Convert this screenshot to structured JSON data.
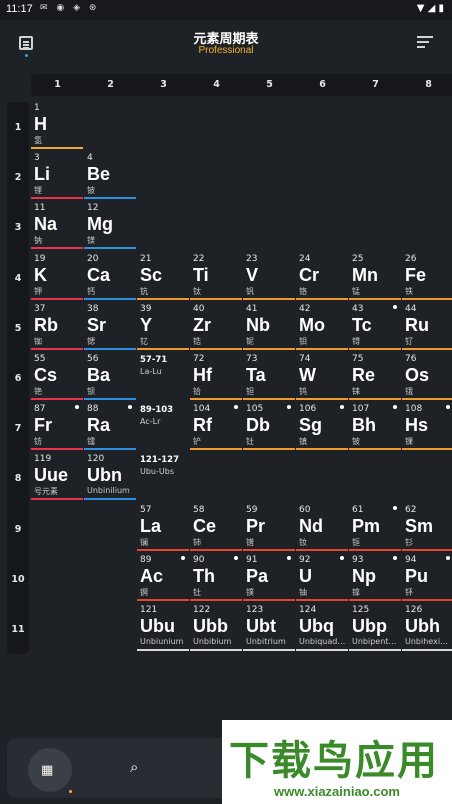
{
  "status_bar": {
    "time": "11:17"
  },
  "app_bar": {
    "title": "元素周期表",
    "subtitle": "Professional"
  },
  "columns": [
    "1",
    "2",
    "3",
    "4",
    "5",
    "6",
    "7",
    "8"
  ],
  "rows": [
    "1",
    "2",
    "3",
    "4",
    "5",
    "6",
    "7",
    "8",
    "9",
    "10",
    "11"
  ],
  "colors": {
    "alkali": "#e8334f",
    "alkaline_earth": "#2f8fe0",
    "transition": "#f39a2c",
    "lanthanide_actinide": "#e8452f",
    "superheavy": "#d9d9d9",
    "hydrogen": "#f2a93b"
  },
  "elements": [
    {
      "n": "1",
      "s": "H",
      "name": "氢",
      "cat": "hydrogen",
      "r": 0,
      "c": 0
    },
    {
      "n": "3",
      "s": "Li",
      "name": "锂",
      "cat": "alkali",
      "r": 1,
      "c": 0
    },
    {
      "n": "4",
      "s": "Be",
      "name": "铍",
      "cat": "alkaline_earth",
      "r": 1,
      "c": 1
    },
    {
      "n": "11",
      "s": "Na",
      "name": "钠",
      "cat": "alkali",
      "r": 2,
      "c": 0
    },
    {
      "n": "12",
      "s": "Mg",
      "name": "镁",
      "cat": "alkaline_earth",
      "r": 2,
      "c": 1
    },
    {
      "n": "19",
      "s": "K",
      "name": "钾",
      "cat": "alkali",
      "r": 3,
      "c": 0
    },
    {
      "n": "20",
      "s": "Ca",
      "name": "钙",
      "cat": "alkaline_earth",
      "r": 3,
      "c": 1
    },
    {
      "n": "21",
      "s": "Sc",
      "name": "钪",
      "cat": "transition",
      "r": 3,
      "c": 2
    },
    {
      "n": "22",
      "s": "Ti",
      "name": "钛",
      "cat": "transition",
      "r": 3,
      "c": 3
    },
    {
      "n": "23",
      "s": "V",
      "name": "钒",
      "cat": "transition",
      "r": 3,
      "c": 4
    },
    {
      "n": "24",
      "s": "Cr",
      "name": "铬",
      "cat": "transition",
      "r": 3,
      "c": 5
    },
    {
      "n": "25",
      "s": "Mn",
      "name": "锰",
      "cat": "transition",
      "r": 3,
      "c": 6
    },
    {
      "n": "26",
      "s": "Fe",
      "name": "铁",
      "cat": "transition",
      "r": 3,
      "c": 7
    },
    {
      "n": "37",
      "s": "Rb",
      "name": "铷",
      "cat": "alkali",
      "r": 4,
      "c": 0
    },
    {
      "n": "38",
      "s": "Sr",
      "name": "锶",
      "cat": "alkaline_earth",
      "r": 4,
      "c": 1
    },
    {
      "n": "39",
      "s": "Y",
      "name": "钇",
      "cat": "transition",
      "r": 4,
      "c": 2
    },
    {
      "n": "40",
      "s": "Zr",
      "name": "锆",
      "cat": "transition",
      "r": 4,
      "c": 3
    },
    {
      "n": "41",
      "s": "Nb",
      "name": "铌",
      "cat": "transition",
      "r": 4,
      "c": 4
    },
    {
      "n": "42",
      "s": "Mo",
      "name": "钼",
      "cat": "transition",
      "r": 4,
      "c": 5
    },
    {
      "n": "43",
      "s": "Tc",
      "name": "锝",
      "cat": "transition",
      "r": 4,
      "c": 6,
      "dot": true
    },
    {
      "n": "44",
      "s": "Ru",
      "name": "钌",
      "cat": "transition",
      "r": 4,
      "c": 7
    },
    {
      "n": "55",
      "s": "Cs",
      "name": "铯",
      "cat": "alkali",
      "r": 5,
      "c": 0
    },
    {
      "n": "56",
      "s": "Ba",
      "name": "钡",
      "cat": "alkaline_earth",
      "r": 5,
      "c": 1
    },
    {
      "n": "72",
      "s": "Hf",
      "name": "铪",
      "cat": "transition",
      "r": 5,
      "c": 3
    },
    {
      "n": "73",
      "s": "Ta",
      "name": "钽",
      "cat": "transition",
      "r": 5,
      "c": 4
    },
    {
      "n": "74",
      "s": "W",
      "name": "钨",
      "cat": "transition",
      "r": 5,
      "c": 5
    },
    {
      "n": "75",
      "s": "Re",
      "name": "铼",
      "cat": "transition",
      "r": 5,
      "c": 6
    },
    {
      "n": "76",
      "s": "Os",
      "name": "锇",
      "cat": "transition",
      "r": 5,
      "c": 7
    },
    {
      "n": "87",
      "s": "Fr",
      "name": "钫",
      "cat": "alkali",
      "r": 6,
      "c": 0,
      "dot": true
    },
    {
      "n": "88",
      "s": "Ra",
      "name": "镭",
      "cat": "alkaline_earth",
      "r": 6,
      "c": 1,
      "dot": true
    },
    {
      "n": "104",
      "s": "Rf",
      "name": "铲",
      "cat": "transition",
      "r": 6,
      "c": 3,
      "dot": true
    },
    {
      "n": "105",
      "s": "Db",
      "name": "钍",
      "cat": "transition",
      "r": 6,
      "c": 4,
      "dot": true
    },
    {
      "n": "106",
      "s": "Sg",
      "name": "镇",
      "cat": "transition",
      "r": 6,
      "c": 5,
      "dot": true
    },
    {
      "n": "107",
      "s": "Bh",
      "name": "铍",
      "cat": "transition",
      "r": 6,
      "c": 6,
      "dot": true
    },
    {
      "n": "108",
      "s": "Hs",
      "name": "锞",
      "cat": "transition",
      "r": 6,
      "c": 7,
      "dot": true
    },
    {
      "n": "119",
      "s": "Uue",
      "name": "号元素",
      "cat": "alkali",
      "r": 7,
      "c": 0
    },
    {
      "n": "120",
      "s": "Ubn",
      "name": "Unbinilium",
      "cat": "alkaline_earth",
      "r": 7,
      "c": 1
    },
    {
      "n": "57",
      "s": "La",
      "name": "镧",
      "cat": "lanthanide_actinide",
      "r": 8,
      "c": 2
    },
    {
      "n": "58",
      "s": "Ce",
      "name": "铈",
      "cat": "lanthanide_actinide",
      "r": 8,
      "c": 3
    },
    {
      "n": "59",
      "s": "Pr",
      "name": "镨",
      "cat": "lanthanide_actinide",
      "r": 8,
      "c": 4
    },
    {
      "n": "60",
      "s": "Nd",
      "name": "钕",
      "cat": "lanthanide_actinide",
      "r": 8,
      "c": 5
    },
    {
      "n": "61",
      "s": "Pm",
      "name": "钷",
      "cat": "lanthanide_actinide",
      "r": 8,
      "c": 6,
      "dot": true
    },
    {
      "n": "62",
      "s": "Sm",
      "name": "钐",
      "cat": "lanthanide_actinide",
      "r": 8,
      "c": 7
    },
    {
      "n": "89",
      "s": "Ac",
      "name": "锕",
      "cat": "lanthanide_actinide",
      "r": 9,
      "c": 2,
      "dot": true
    },
    {
      "n": "90",
      "s": "Th",
      "name": "钍",
      "cat": "lanthanide_actinide",
      "r": 9,
      "c": 3,
      "dot": true
    },
    {
      "n": "91",
      "s": "Pa",
      "name": "镤",
      "cat": "lanthanide_actinide",
      "r": 9,
      "c": 4,
      "dot": true
    },
    {
      "n": "92",
      "s": "U",
      "name": "铀",
      "cat": "lanthanide_actinide",
      "r": 9,
      "c": 5,
      "dot": true
    },
    {
      "n": "93",
      "s": "Np",
      "name": "镎",
      "cat": "lanthanide_actinide",
      "r": 9,
      "c": 6,
      "dot": true
    },
    {
      "n": "94",
      "s": "Pu",
      "name": "钚",
      "cat": "lanthanide_actinide",
      "r": 9,
      "c": 7,
      "dot": true
    },
    {
      "n": "121",
      "s": "Ubu",
      "name": "Unbiunium",
      "cat": "superheavy",
      "r": 10,
      "c": 2
    },
    {
      "n": "122",
      "s": "Ubb",
      "name": "Unbibium",
      "cat": "superheavy",
      "r": 10,
      "c": 3
    },
    {
      "n": "123",
      "s": "Ubt",
      "name": "Unbitrium",
      "cat": "superheavy",
      "r": 10,
      "c": 4
    },
    {
      "n": "124",
      "s": "Ubq",
      "name": "Unbiquad…",
      "cat": "superheavy",
      "r": 10,
      "c": 5
    },
    {
      "n": "125",
      "s": "Ubp",
      "name": "Unbipent…",
      "cat": "superheavy",
      "r": 10,
      "c": 6
    },
    {
      "n": "126",
      "s": "Ubh",
      "name": "Unbihexi…",
      "cat": "superheavy",
      "r": 10,
      "c": 7
    }
  ],
  "series_refs": [
    {
      "range": "57-71",
      "label": "La-Lu",
      "r": 5,
      "c": 2
    },
    {
      "range": "89-103",
      "label": "Ac-Lr",
      "r": 6,
      "c": 2
    },
    {
      "range": "121-127",
      "label": "Ubu-Ubs",
      "r": 7,
      "c": 2
    }
  ],
  "watermark": {
    "cn": "下载鸟应用",
    "en": "www.xiazainiao.com"
  }
}
